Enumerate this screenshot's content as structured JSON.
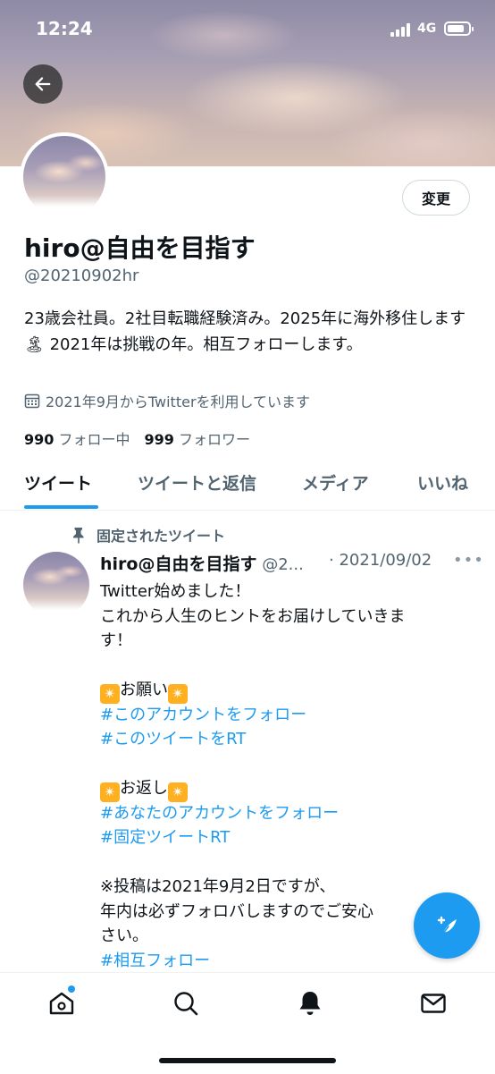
{
  "status_bar": {
    "time": "12:24",
    "network": "4G"
  },
  "profile": {
    "edit_label": "変更",
    "display_name": "hiro@自由を目指す",
    "handle": "@20210902hr",
    "bio": "23歳会社員。2社目転職経験済み。2025年に海外移住します🏝 2021年は挑戦の年。相互フォローします。",
    "joined": "2021年9月からTwitterを利用しています",
    "following_count": "990",
    "following_label": "フォロー中",
    "followers_count": "999",
    "followers_label": "フォロワー"
  },
  "tabs": [
    "ツイート",
    "ツイートと返信",
    "メディア",
    "いいね"
  ],
  "pinned_tweet": {
    "pinned_label": "固定されたツイート",
    "name": "hiro@自由を目指す",
    "handle": "@2...",
    "date": "· 2021/09/02",
    "lines": [
      "Twitter始めました！",
      "これから人生のヒントをお届けしていきま",
      "す！",
      "お願い",
      "#このアカウントをフォロー",
      "#このツイートをRT",
      "お返し",
      "#あなたのアカウントをフォロー",
      "#固定ツイートRT",
      "※投稿は2021年9月2日ですが、",
      "年内は必ずフォロバしますのでご安心",
      "さい。",
      "#相互フォロー"
    ]
  },
  "colors": {
    "accent": "#1d9bf0",
    "secondary_text": "#536471"
  },
  "icons": {
    "back": "arrow-left-icon",
    "calendar": "calendar-icon",
    "pin": "pin-icon",
    "compose": "compose-tweet-icon",
    "nav": [
      "home-icon",
      "search-icon",
      "notifications-bell-icon",
      "messages-envelope-icon"
    ]
  }
}
